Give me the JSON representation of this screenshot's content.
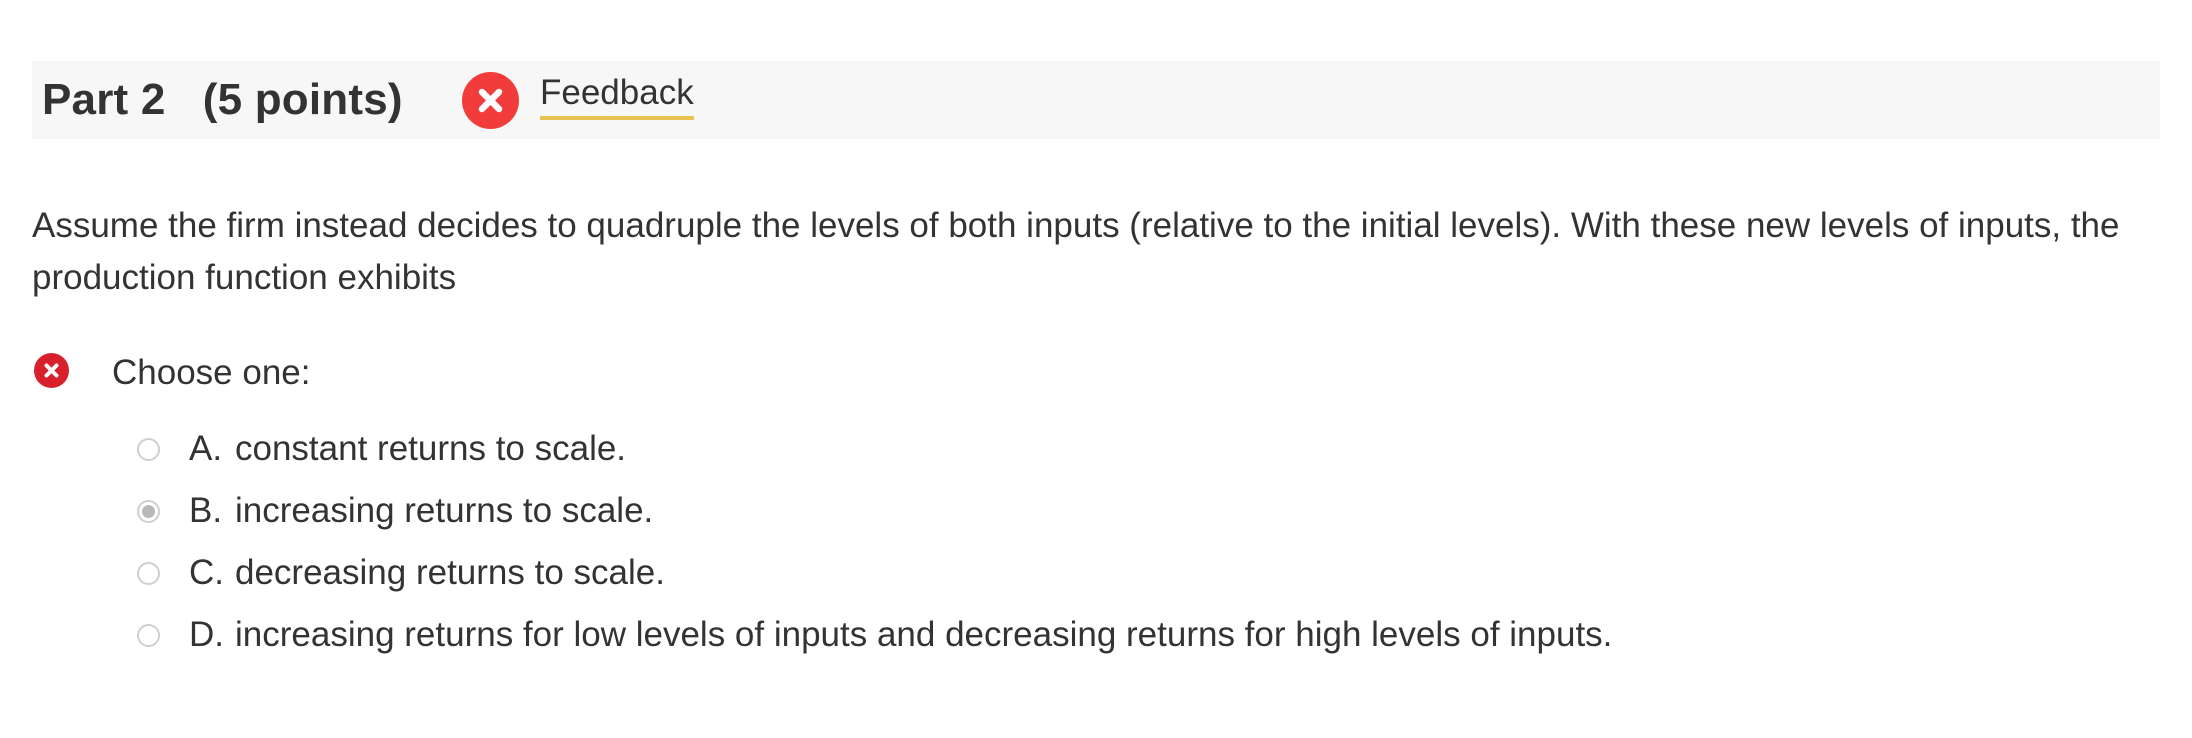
{
  "part": {
    "title": "Part 2   (5 points)",
    "status_icon": "x-circle-icon",
    "status_color": "#f23c3c",
    "feedback_label": "Feedback",
    "feedback_underline_color": "#e9c34f"
  },
  "question": {
    "text": "Assume the firm instead decides to quadruple the levels of both inputs (relative to the initial levels). With these new levels of inputs, the production function exhibits"
  },
  "answer": {
    "result_icon": "x-circle-icon",
    "result_color": "#d8202c",
    "prompt": "Choose one:",
    "selected": "B",
    "options": [
      {
        "letter": "A.",
        "text": "constant returns to scale.",
        "selected": false
      },
      {
        "letter": "B.",
        "text": "increasing returns to scale.",
        "selected": true
      },
      {
        "letter": "C.",
        "text": "decreasing returns to scale.",
        "selected": false
      },
      {
        "letter": "D.",
        "text": "increasing returns for low levels of inputs and decreasing returns for high levels of inputs.",
        "selected": false
      }
    ]
  }
}
